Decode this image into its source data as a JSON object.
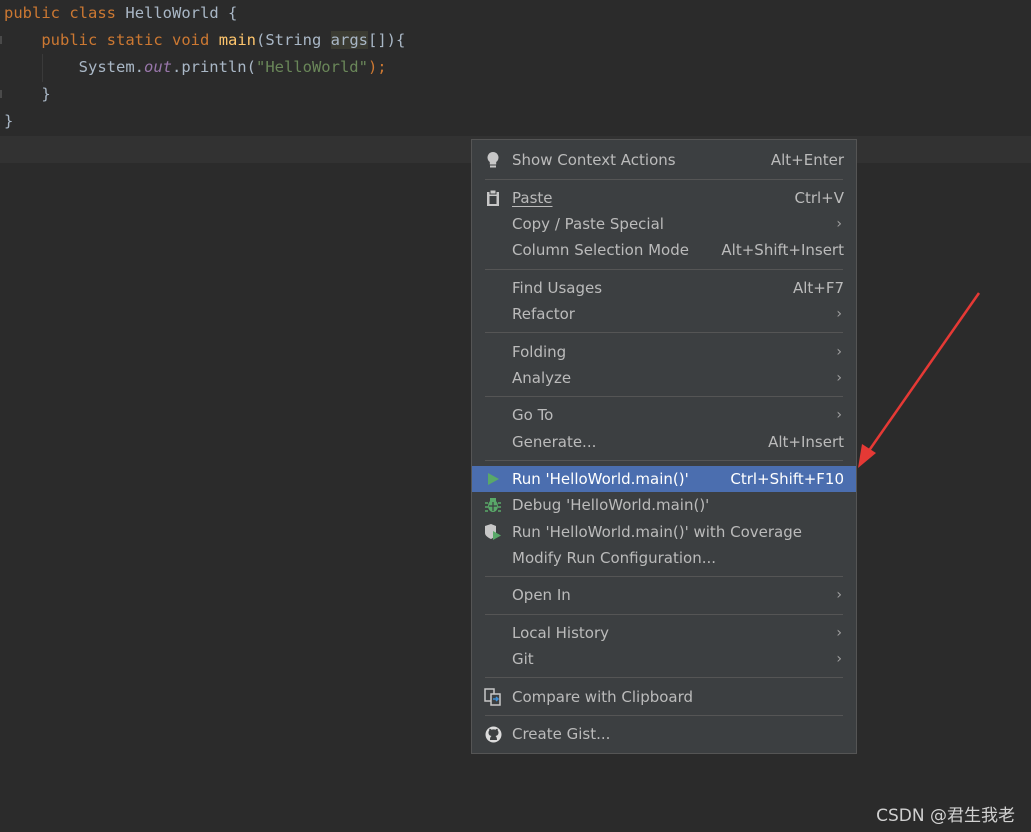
{
  "editor": {
    "line1": {
      "kw1": "public",
      "kw2": "class",
      "cls": "HelloWorld",
      "brace": "{"
    },
    "line2": {
      "kw1": "public",
      "kw2": "static",
      "kw3": "void",
      "fn": "main",
      "open": "(String ",
      "param": "args",
      "rest": "[]){"
    },
    "line3": {
      "obj": "System.",
      "field": "out",
      "call": ".println(",
      "str": "\"HelloWorld\"",
      "end": ");"
    },
    "line4": {
      "brace": "}"
    },
    "line5": {
      "brace": "}"
    }
  },
  "menu": {
    "items": [
      {
        "label": "Show Context Actions",
        "shortcut": "Alt+Enter",
        "icon": "lightbulb-icon"
      },
      {
        "label": "Paste",
        "shortcut": "Ctrl+V",
        "icon": "clipboard-icon"
      },
      {
        "label": "Copy / Paste Special",
        "submenu": true
      },
      {
        "label": "Column Selection Mode",
        "shortcut": "Alt+Shift+Insert"
      },
      {
        "label": "Find Usages",
        "shortcut": "Alt+F7"
      },
      {
        "label": "Refactor",
        "submenu": true
      },
      {
        "label": "Folding",
        "submenu": true
      },
      {
        "label": "Analyze",
        "submenu": true
      },
      {
        "label": "Go To",
        "submenu": true
      },
      {
        "label": "Generate...",
        "shortcut": "Alt+Insert"
      },
      {
        "label": "Run 'HelloWorld.main()'",
        "shortcut": "Ctrl+Shift+F10",
        "icon": "run-icon",
        "selected": true
      },
      {
        "label": "Debug 'HelloWorld.main()'",
        "icon": "debug-bug-icon"
      },
      {
        "label": "Run 'HelloWorld.main()' with Coverage",
        "icon": "coverage-icon"
      },
      {
        "label": "Modify Run Configuration..."
      },
      {
        "label": "Open In",
        "submenu": true
      },
      {
        "label": "Local History",
        "submenu": true
      },
      {
        "label": "Git",
        "submenu": true
      },
      {
        "label": "Compare with Clipboard",
        "icon": "compare-icon"
      },
      {
        "label": "Create Gist...",
        "icon": "github-icon"
      }
    ],
    "arrow_glyph": "›"
  },
  "watermark": "CSDN @君生我老",
  "colors": {
    "selection": "#4b6eaf",
    "menu_bg": "#3c3f41",
    "editor_bg": "#2b2b2b",
    "arrow": "#e53935"
  }
}
